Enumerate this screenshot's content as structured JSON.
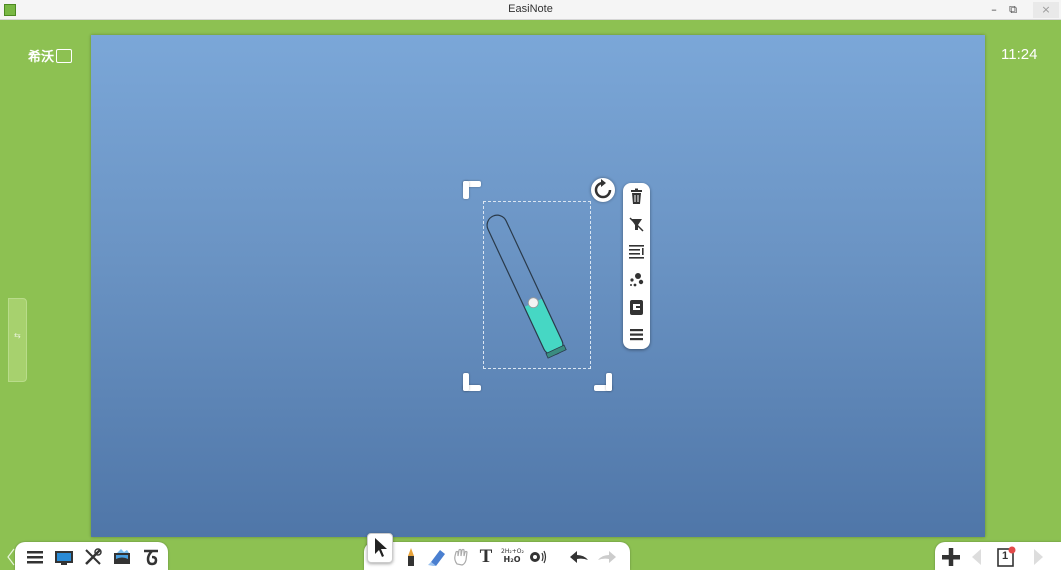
{
  "window": {
    "title": "EasiNote",
    "minimize_glyph": "–",
    "restore_glyph": "⧉",
    "close_glyph": "×"
  },
  "frame": {
    "logo_text": "希沃",
    "clock": "11:24",
    "side_handle_glyph": "⇆"
  },
  "selection": {
    "object": "test-tube",
    "fill_level": 0.35,
    "context_menu": [
      "trash-icon",
      "hide-icon",
      "align-icon",
      "effects-icon",
      "layer-icon",
      "more-menu-icon"
    ]
  },
  "toolbar_left": [
    "menu-icon",
    "screen-icon",
    "tools-icon",
    "courseware-icon",
    "subject-tools-icon"
  ],
  "toolbar_mid": {
    "tools": [
      "select-tool",
      "pen-tool",
      "eraser-tool",
      "roam-tool",
      "text-tool",
      "formula-tool",
      "audio-tool",
      "undo",
      "redo"
    ],
    "text_tool_label": "T",
    "formula_line1": "2H₂+O₂",
    "formula_line2": "H₂O"
  },
  "toolbar_right": {
    "page": "1",
    "tools": [
      "add-page",
      "prev-page",
      "page-list",
      "next-page"
    ]
  },
  "colors": {
    "frame_green": "#8dc152",
    "canvas_top": "#7ba7d8",
    "canvas_bottom": "#4f76a8",
    "liquid": "#46d7c4"
  }
}
